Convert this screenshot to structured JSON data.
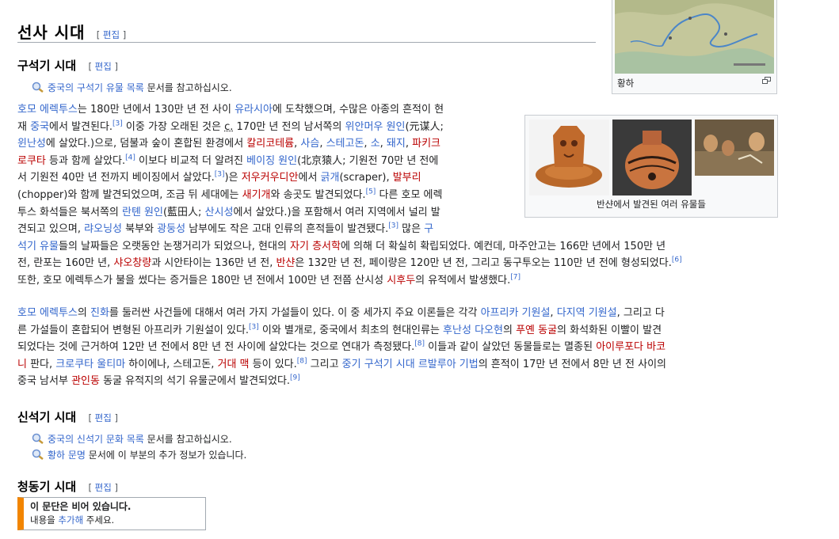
{
  "map": {
    "caption": "황하"
  },
  "section_title": "선사 시대",
  "edit_label": "편집",
  "paleo": {
    "heading": "구석기 시대",
    "hatnote_link": "중국의 구석기 유물 목록",
    "hatnote_suffix": " 문서를 참고하십시오."
  },
  "gallery": {
    "caption": "반샨에서 발견된 여러 유물들"
  },
  "neo": {
    "heading": "신석기 시대",
    "hatnote1_link": "중국의 신석기 문화 목록",
    "hatnote1_suffix": " 문서를 참고하십시오.",
    "hatnote2_link": "황하 문명",
    "hatnote2_suffix": " 문서에 이 부분의 추가 정보가 있습니다."
  },
  "bronze": {
    "heading": "청동기 시대",
    "empty_title": "이 문단은 비어 있습니다.",
    "empty_pre": "내용을 ",
    "empty_link": "추가해",
    "empty_post": " 주세요."
  },
  "colors": {
    "link": "#3366cc",
    "redlink": "#ba0000",
    "accent": "#f28500"
  },
  "para1": {
    "lines": [
      [
        {
          "t": "호모 에렉투스",
          "k": "l"
        },
        {
          "t": "는 180만 년에서 130만 년 전 사이 "
        },
        {
          "t": "유라시아",
          "k": "l"
        },
        {
          "t": "에 도착했으며, 수많은 아종의 흔적이 현"
        }
      ],
      [
        {
          "t": "재 "
        },
        {
          "t": "중국",
          "k": "l"
        },
        {
          "t": "에서 발견된다."
        },
        {
          "t": "[3]",
          "k": "s"
        },
        {
          "t": " 이중 가장 오래된 것은 "
        },
        {
          "t": "c.",
          "k": "u"
        },
        {
          "t": " 170만 년 전의 남서쪽의 "
        },
        {
          "t": "위안머우 원인",
          "k": "l"
        },
        {
          "t": "(元谋人;"
        }
      ],
      [
        {
          "t": "윈난성",
          "k": "l"
        },
        {
          "t": "에 살았다.)으로, 덤불과 숲이 혼합된 환경에서 "
        },
        {
          "t": "칼리코테륨",
          "k": "r"
        },
        {
          "t": ", "
        },
        {
          "t": "사슴",
          "k": "l"
        },
        {
          "t": ", "
        },
        {
          "t": "스테고돈",
          "k": "l"
        },
        {
          "t": ", "
        },
        {
          "t": "소",
          "k": "l"
        },
        {
          "t": ", "
        },
        {
          "t": "돼지",
          "k": "l"
        },
        {
          "t": ", "
        },
        {
          "t": "파키크",
          "k": "r"
        }
      ],
      [
        {
          "t": "로쿠타",
          "k": "r"
        },
        {
          "t": " 등과 함께 살았다."
        },
        {
          "t": "[4]",
          "k": "s"
        },
        {
          "t": " 이보다 비교적 더 알려진 "
        },
        {
          "t": "베이징 원인",
          "k": "l"
        },
        {
          "t": "(北京猿人; 기원전 70만 년 전에"
        }
      ],
      [
        {
          "t": "서 기원전 40만 년 전까지 베이징에서 살았다."
        },
        {
          "t": "[3]",
          "k": "s"
        },
        {
          "t": ")은 "
        },
        {
          "t": "저우커우디안",
          "k": "r"
        },
        {
          "t": "에서 "
        },
        {
          "t": "긁개",
          "k": "l"
        },
        {
          "t": "(scraper), "
        },
        {
          "t": "발부리",
          "k": "r"
        }
      ],
      [
        {
          "t": "(chopper)와 함께 발견되었으며, 조금 뒤 세대에는 "
        },
        {
          "t": "새기개",
          "k": "r"
        },
        {
          "t": "와 송곳도 발견되었다."
        },
        {
          "t": "[5]",
          "k": "s"
        },
        {
          "t": " 다른 호모 에렉"
        }
      ],
      [
        {
          "t": "투스 화석들은 북서쪽의 "
        },
        {
          "t": "란톈 원인",
          "k": "l"
        },
        {
          "t": "(藍田人; "
        },
        {
          "t": "산시성",
          "k": "l"
        },
        {
          "t": "에서 살았다.)을 포함해서 여러 지역에서 널리 발"
        }
      ],
      [
        {
          "t": "견되고 있으며, "
        },
        {
          "t": "랴오닝성",
          "k": "l"
        },
        {
          "t": " 북부와 "
        },
        {
          "t": "광둥성",
          "k": "l"
        },
        {
          "t": " 남부에도 작은 고대 인류의 흔적들이 발견됐다."
        },
        {
          "t": "[3]",
          "k": "s"
        },
        {
          "t": " 많은 "
        },
        {
          "t": "구",
          "k": "l"
        }
      ],
      [
        {
          "t": "석기 유물",
          "k": "l"
        },
        {
          "t": "들의 날짜들은 오랫동안 논쟁거리가 되었으나, 현대의 "
        },
        {
          "t": "자기 층서학",
          "k": "r"
        },
        {
          "t": "에 의해 더 확실히 확립되었다. 예컨데, 마주안고는 166만 년에서 150만 년"
        }
      ],
      [
        {
          "t": "전, 란포는 160만 년, "
        },
        {
          "t": "샤오창량",
          "k": "r"
        },
        {
          "t": "과 시안타이는 136만 년 전, "
        },
        {
          "t": "반샨",
          "k": "r"
        },
        {
          "t": "은 132만 년 전, 페이량은 120만 년 전, 그리고 동구투오는 110만 년 전에 형성되었다."
        },
        {
          "t": "[6]",
          "k": "s"
        }
      ],
      [
        {
          "t": "또한, 호모 에렉투스가 불을 썼다는 증거들은 180만 년 전에서 100만 년 전쯤 산시성 "
        },
        {
          "t": "시후두",
          "k": "r"
        },
        {
          "t": "의 유적에서 발생했다."
        },
        {
          "t": "[7]",
          "k": "s"
        }
      ]
    ]
  },
  "para2": {
    "lines": [
      [
        {
          "t": "호모 에렉투스",
          "k": "l"
        },
        {
          "t": "의 "
        },
        {
          "t": "진화",
          "k": "l"
        },
        {
          "t": "를 둘러싼 사건들에 대해서 여러 가지 가설들이 있다. 이 중 세가지 주요 이론들은 각각 "
        },
        {
          "t": "아프리카 기원설",
          "k": "l"
        },
        {
          "t": ", "
        },
        {
          "t": "다지역 기원설",
          "k": "l"
        },
        {
          "t": ", 그리고 다"
        }
      ],
      [
        {
          "t": "른 가설들이 혼합되어 변형된 아프리카 기원설이 있다."
        },
        {
          "t": "[3]",
          "k": "s"
        },
        {
          "t": " 이와 별개로, 중국에서 최초의 현대인류는 "
        },
        {
          "t": "후난성",
          "k": "l"
        },
        {
          "t": " "
        },
        {
          "t": "다오현",
          "k": "l"
        },
        {
          "t": "의 "
        },
        {
          "t": "푸옌 동굴",
          "k": "r"
        },
        {
          "t": "의 화석화된 이빨이 발견"
        }
      ],
      [
        {
          "t": "되었다는 것에 근거하여 12만 년 전에서 8만 년 전 사이에 살았다는 것으로 연대가 측정됐다."
        },
        {
          "t": "[8]",
          "k": "s"
        },
        {
          "t": " 이들과 같이 살았던 동물들로는 멸종된 "
        },
        {
          "t": "아이루포다 바코",
          "k": "r"
        }
      ],
      [
        {
          "t": "니",
          "k": "r"
        },
        {
          "t": " 판다, "
        },
        {
          "t": "크로쿠타 울티마",
          "k": "l"
        },
        {
          "t": " 하이에나, 스테고돈, "
        },
        {
          "t": "거대 맥",
          "k": "r"
        },
        {
          "t": " 등이 있다."
        },
        {
          "t": "[8]",
          "k": "s"
        },
        {
          "t": " 그리고 "
        },
        {
          "t": "중기 구석기 시대",
          "k": "l"
        },
        {
          "t": " "
        },
        {
          "t": "르발루아 기법",
          "k": "l"
        },
        {
          "t": "의 흔적이 17만 년 전에서 8만 년 전 사이의"
        }
      ],
      [
        {
          "t": "중국 남서부 "
        },
        {
          "t": "관인동",
          "k": "r"
        },
        {
          "t": " 동굴 유적지의 석기 유물군에서 발견되었다."
        },
        {
          "t": "[9]",
          "k": "s"
        }
      ]
    ]
  }
}
